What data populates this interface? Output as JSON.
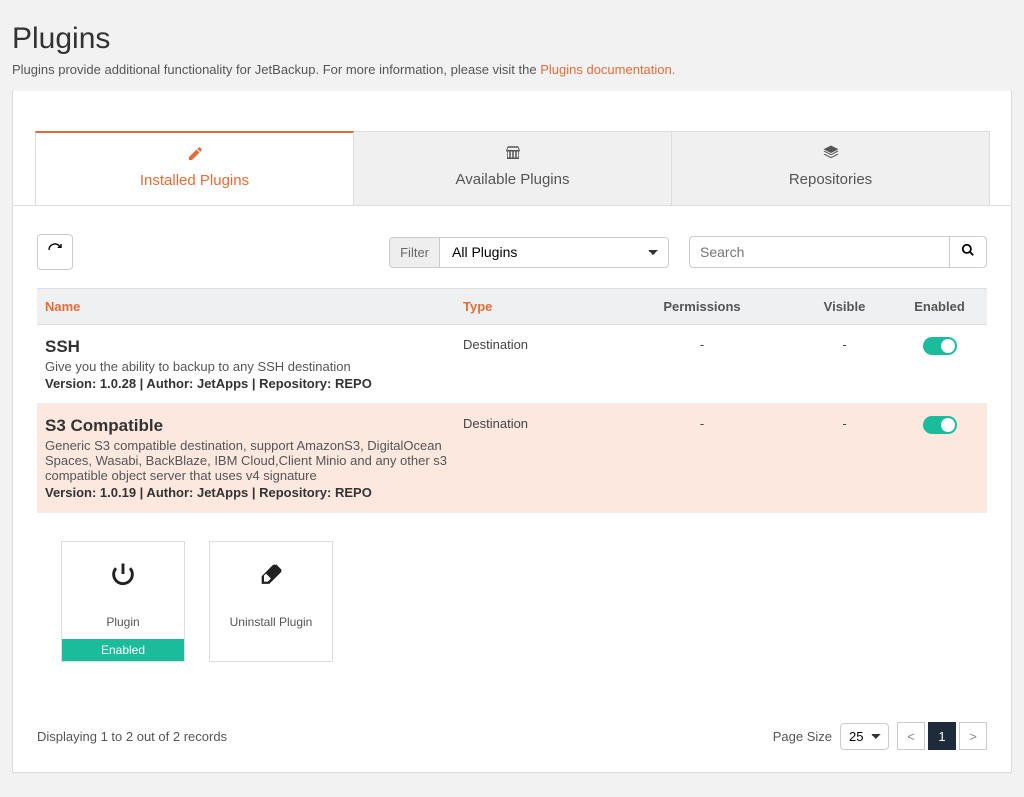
{
  "page": {
    "title": "Plugins",
    "subtitle_pre": "Plugins provide additional functionality for JetBackup. For more information, please visit the ",
    "subtitle_link": "Plugins documentation."
  },
  "tabs": [
    {
      "label": "Installed Plugins",
      "active": true
    },
    {
      "label": "Available Plugins",
      "active": false
    },
    {
      "label": "Repositories",
      "active": false
    }
  ],
  "filter": {
    "label": "Filter",
    "selected": "All Plugins"
  },
  "search": {
    "placeholder": "Search"
  },
  "columns": {
    "name": "Name",
    "type": "Type",
    "permissions": "Permissions",
    "visible": "Visible",
    "enabled": "Enabled"
  },
  "plugins": [
    {
      "name": "SSH",
      "desc": "Give you the ability to backup to any SSH destination",
      "meta": "Version: 1.0.28 | Author: JetApps | Repository: REPO",
      "type": "Destination",
      "permissions": "-",
      "visible": "-",
      "enabled": true
    },
    {
      "name": "S3 Compatible",
      "desc": "Generic S3 compatible destination, support AmazonS3, DigitalOcean Spaces, Wasabi, BackBlaze, IBM Cloud,Client Minio and any other s3 compatible object server that uses v4 signature",
      "meta": "Version: 1.0.19 | Author: JetApps | Repository: REPO",
      "type": "Destination",
      "permissions": "-",
      "visible": "-",
      "enabled": true
    }
  ],
  "actions": {
    "plugin": {
      "label": "Plugin",
      "status": "Enabled"
    },
    "uninstall": {
      "label": "Uninstall Plugin"
    }
  },
  "footer": {
    "display_text": "Displaying 1 to 2 out of 2 records",
    "page_size_label": "Page Size",
    "page_size_value": "25",
    "current_page": "1"
  }
}
